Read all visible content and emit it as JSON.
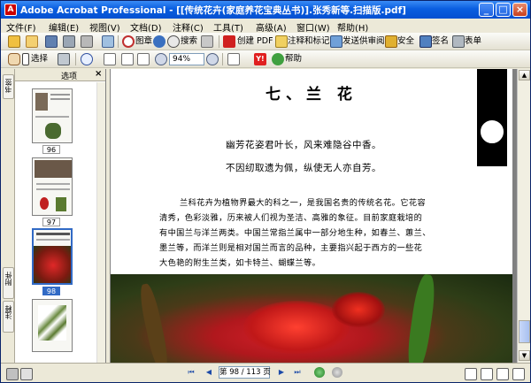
{
  "window": {
    "title": "Adobe Acrobat Professional - [[传统花卉(家庭养花宝典丛书)].张秀新等.扫描版.pdf]",
    "minimize": "_",
    "maximize": "□",
    "close": "×"
  },
  "menu": [
    "文件(F)",
    "编辑(E)",
    "视图(V)",
    "文档(D)",
    "注释(C)",
    "工具(T)",
    "高级(A)",
    "窗口(W)",
    "帮助(H)"
  ],
  "toolbar1": {
    "image_label": "图章",
    "search_label": "搜索",
    "create_pdf": "创建 PDF",
    "comment_markup": "注释和标记",
    "send_review": "发送供审阅",
    "security": "安全",
    "sign": "签名",
    "forms": "表单"
  },
  "toolbar2": {
    "select_label": "选择",
    "zoom_value": "94%",
    "help_label": "帮助"
  },
  "side_panel": {
    "options_label": "选项",
    "close": "×",
    "tab_top": "书签",
    "tab_mid": "附件",
    "tab_bottom": "注释",
    "pages": [
      {
        "label": "96",
        "selected": false
      },
      {
        "label": "97",
        "selected": false
      },
      {
        "label": "98",
        "selected": true
      }
    ]
  },
  "document": {
    "heading": "七、兰  花",
    "poem_line1": "幽芳花姿君叶长，风来难隐谷中香。",
    "poem_line2": "不因纫取遗为佩，纵使无人亦自芳。",
    "body": [
      "兰科花卉为植物界最大的科之一，是我国名贵的传统名花。它花容",
      "清秀，色彩淡雅，历来被人们视为圣洁、高雅的象征。目前家庭栽培的",
      "有中国兰与洋兰两类。中国兰常指兰属中一部分地生种，如春兰、蕙兰、",
      "墨兰等，而洋兰则是相对国兰而言的品种，主要指兴起于西方的一些花",
      "大色艳的附生兰类，如卡特兰、蝴蝶兰等。"
    ]
  },
  "status": {
    "page_indicator": "第 98 / 113 页"
  }
}
